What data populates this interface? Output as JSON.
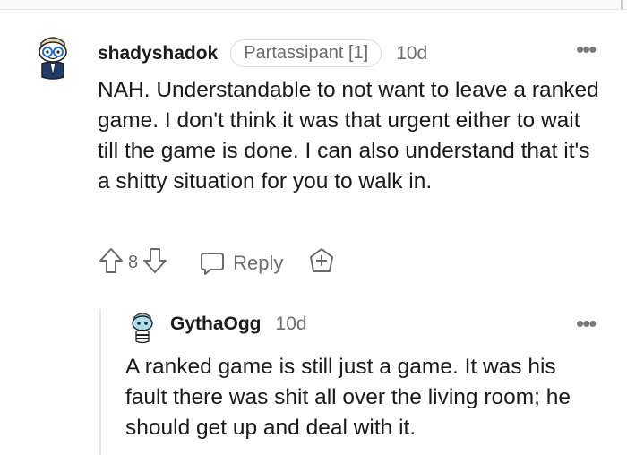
{
  "comments": [
    {
      "username": "shadyshadok",
      "flair": "Partassipant [1]",
      "age": "10d",
      "body": "NAH. Understandable to not want to leave a ranked game. I don't think it was that urgent either to wait till the game is done. I can also understand that it's a shitty situation for you to walk in.",
      "score": "8",
      "reply_label": "Reply"
    },
    {
      "username": "GythaOgg",
      "age": "10d",
      "body": "A ranked game is still just a game. It was his fault there was shit all over the living room; he should get up and deal with it."
    }
  ],
  "icons": {
    "more": "more-options-icon",
    "upvote": "upvote-arrow-icon",
    "downvote": "downvote-arrow-icon",
    "reply": "speech-bubble-icon",
    "award": "award-plus-icon"
  }
}
